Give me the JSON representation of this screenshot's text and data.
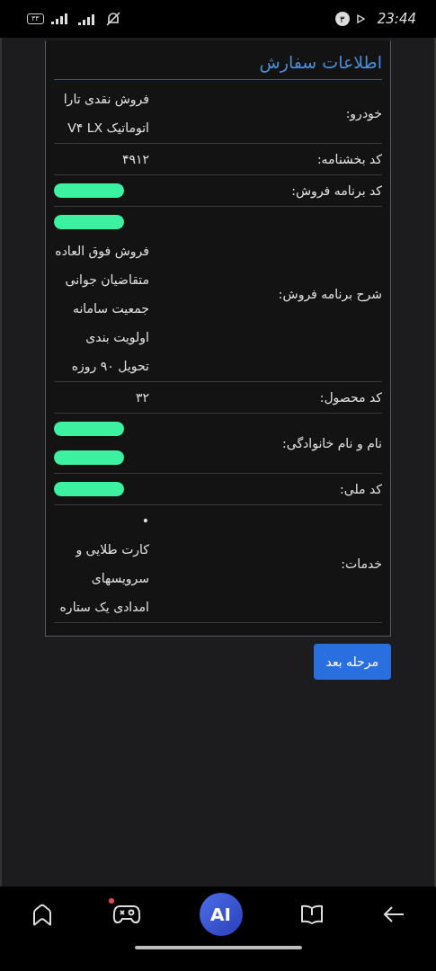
{
  "status_bar": {
    "battery": "۳۳",
    "notification_count": "۳",
    "time": "23:44"
  },
  "card": {
    "title": "اطلاعات سفارش",
    "rows": [
      {
        "label": "خودرو:",
        "values": [
          {
            "kind": "text",
            "text": "فروش نقدی تارا اتوماتیک V۴ LX"
          }
        ]
      },
      {
        "label": "کد بخشنامه:",
        "values": [
          {
            "kind": "text",
            "text": "۴۹۱۲"
          }
        ]
      },
      {
        "label": "کد برنامه فروش:",
        "values": [
          {
            "kind": "redacted"
          }
        ]
      },
      {
        "label": "شرح برنامه فروش:",
        "values": [
          {
            "kind": "redacted"
          },
          {
            "kind": "text",
            "text": "فروش فوق العاده متقاضیان جوانی جمعیت سامانه اولویت بندی تحویل ۹۰ روزه"
          }
        ]
      },
      {
        "label": "کد محصول:",
        "values": [
          {
            "kind": "text",
            "text": "۳۲"
          }
        ]
      },
      {
        "label": "نام و نام خانوادگی:",
        "values": [
          {
            "kind": "redacted"
          },
          {
            "kind": "redacted"
          }
        ]
      },
      {
        "label": "کد ملی:",
        "values": [
          {
            "kind": "redacted"
          }
        ]
      },
      {
        "label": "خدمات:",
        "values": [
          {
            "kind": "text",
            "text": "•"
          },
          {
            "kind": "text",
            "text": "کارت طلایی و سرویسهای امدادی یک ستاره"
          }
        ]
      }
    ]
  },
  "next_button": "مرحله بعد",
  "nav_bar": {
    "ai_label": "AI",
    "games_badge": true
  }
}
